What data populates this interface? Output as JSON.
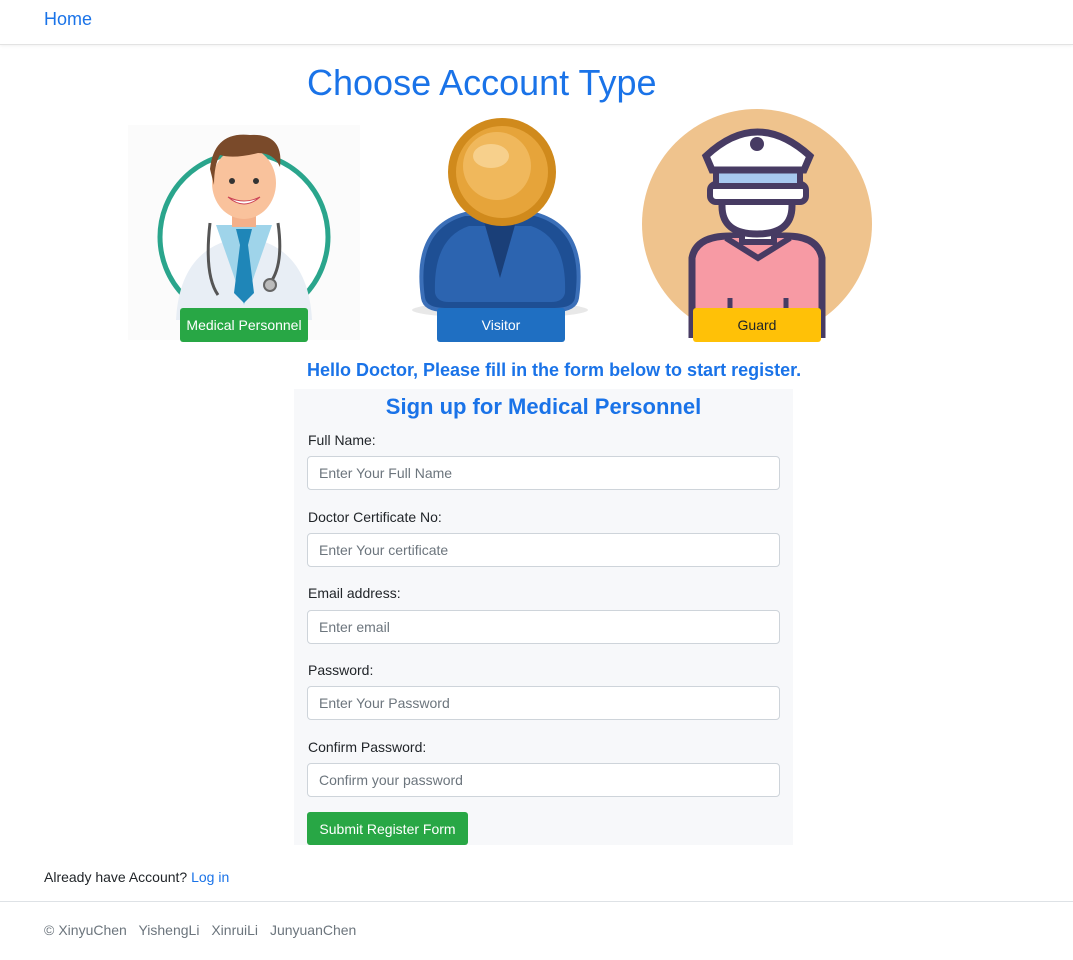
{
  "nav": {
    "home_label": "Home"
  },
  "page_title": "Choose Account Type",
  "account_types": [
    {
      "label": "Medical Personnel",
      "color": "#28a745"
    },
    {
      "label": "Visitor",
      "color": "#1f6fc2"
    },
    {
      "label": "Guard",
      "color": "#ffc107"
    }
  ],
  "hello_text": "Hello Doctor, Please fill in the form below to start register.",
  "form": {
    "title": "Sign up for Medical Personnel",
    "fields": [
      {
        "label": "Full Name:",
        "placeholder": "Enter Your Full Name"
      },
      {
        "label": "Doctor Certificate No:",
        "placeholder": "Enter Your certificate"
      },
      {
        "label": "Email address:",
        "placeholder": "Enter email"
      },
      {
        "label": "Password:",
        "placeholder": "Enter Your Password"
      },
      {
        "label": "Confirm Password:",
        "placeholder": "Confirm your password"
      }
    ],
    "submit_label": "Submit Register Form"
  },
  "login": {
    "prompt": "Already have Account?",
    "link_label": "Log in"
  },
  "footer": {
    "copyright": "©",
    "authors": [
      "XinyuChen",
      "YishengLi",
      "XinruiLi",
      "JunyuanChen"
    ]
  },
  "colors": {
    "accent": "#1a73e8",
    "success": "#28a745",
    "warning": "#ffc107"
  }
}
